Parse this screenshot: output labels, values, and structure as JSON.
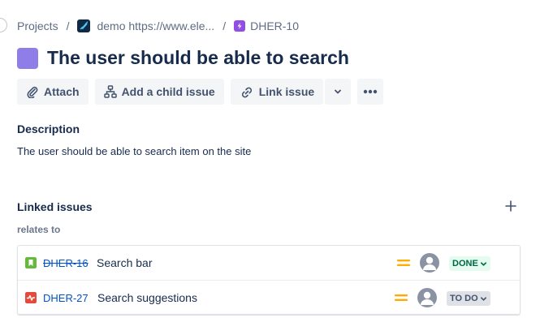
{
  "breadcrumb": {
    "projects": "Projects",
    "separator": "/",
    "project_name": "demo https://www.ele...",
    "issue_key": "DHER-10"
  },
  "issue": {
    "title": "The user should be able to search",
    "title_color": "#8f7ee7"
  },
  "toolbar": {
    "attach_label": "Attach",
    "child_label": "Add a child issue",
    "link_label": "Link issue"
  },
  "description": {
    "heading": "Description",
    "body": "The user should be able to search item on the site"
  },
  "linked": {
    "heading": "Linked issues",
    "relation": "relates to",
    "items": [
      {
        "key": "DHER-16",
        "summary": "Search bar",
        "type_icon": "story-icon",
        "type_color": "#63ba3c",
        "priority_icon": "priority-medium-icon",
        "status": "DONE",
        "status_color": "#006644"
      },
      {
        "key": "DHER-27",
        "summary": "Search suggestions",
        "type_icon": "bug-icon",
        "type_color": "#e5493a",
        "priority_icon": "priority-medium-icon",
        "status": "TO DO",
        "status_color": "#42526e"
      }
    ]
  },
  "colors": {
    "priority": "#ffab00",
    "link": "#0052cc",
    "text": "#172b4d"
  }
}
